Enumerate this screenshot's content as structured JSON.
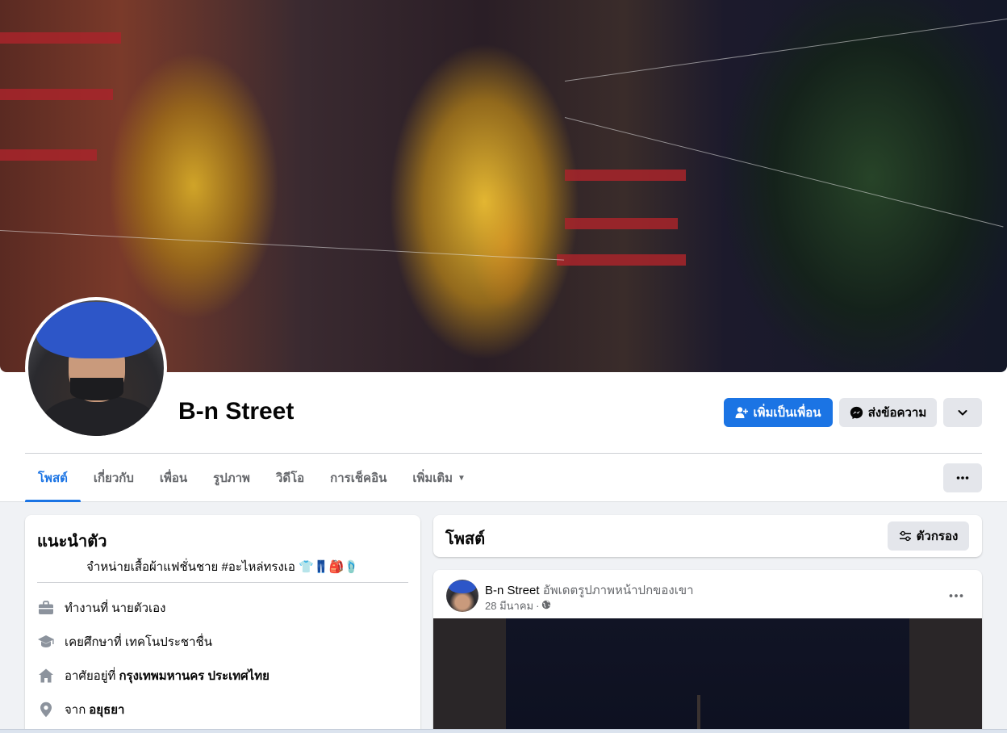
{
  "profile": {
    "name": "B-n Street",
    "add_friend_label": "เพิ่มเป็นเพื่อน",
    "message_label": "ส่งข้อความ"
  },
  "tabs": [
    {
      "label": "โพสต์",
      "active": true
    },
    {
      "label": "เกี่ยวกับ",
      "active": false
    },
    {
      "label": "เพื่อน",
      "active": false
    },
    {
      "label": "รูปภาพ",
      "active": false
    },
    {
      "label": "วิดีโอ",
      "active": false
    },
    {
      "label": "การเช็คอิน",
      "active": false
    },
    {
      "label": "เพิ่มเติม",
      "active": false
    }
  ],
  "intro": {
    "title": "แนะนำตัว",
    "bio": "จำหน่ายเสื้อผ้าแฟชั่นชาย #อะไหล่ทรงเอ 👕👖🎒🩴",
    "work": {
      "prefix": "ทำงานที่",
      "value": "นายตัวเอง"
    },
    "education": {
      "prefix": "เคยศึกษาที่",
      "value": "เทคโนประชาชื่น"
    },
    "lives": {
      "prefix": "อาศัยอยู่ที่",
      "value": "กรุงเทพมหานคร ประเทศไทย"
    },
    "from": {
      "prefix": "จาก",
      "value": "อยุธยา"
    }
  },
  "posts_section": {
    "title": "โพสต์",
    "filter_label": "ตัวกรอง"
  },
  "post": {
    "author": "B-n Street",
    "action": "อัพเดตรูปภาพหน้าปกของเขา",
    "date": "28 มีนาคม",
    "separator": "·",
    "privacy_icon": "globe-icon"
  },
  "colors": {
    "accent": "#1b74e4",
    "background": "#f0f2f5",
    "secondary_button": "#e4e6eb"
  }
}
